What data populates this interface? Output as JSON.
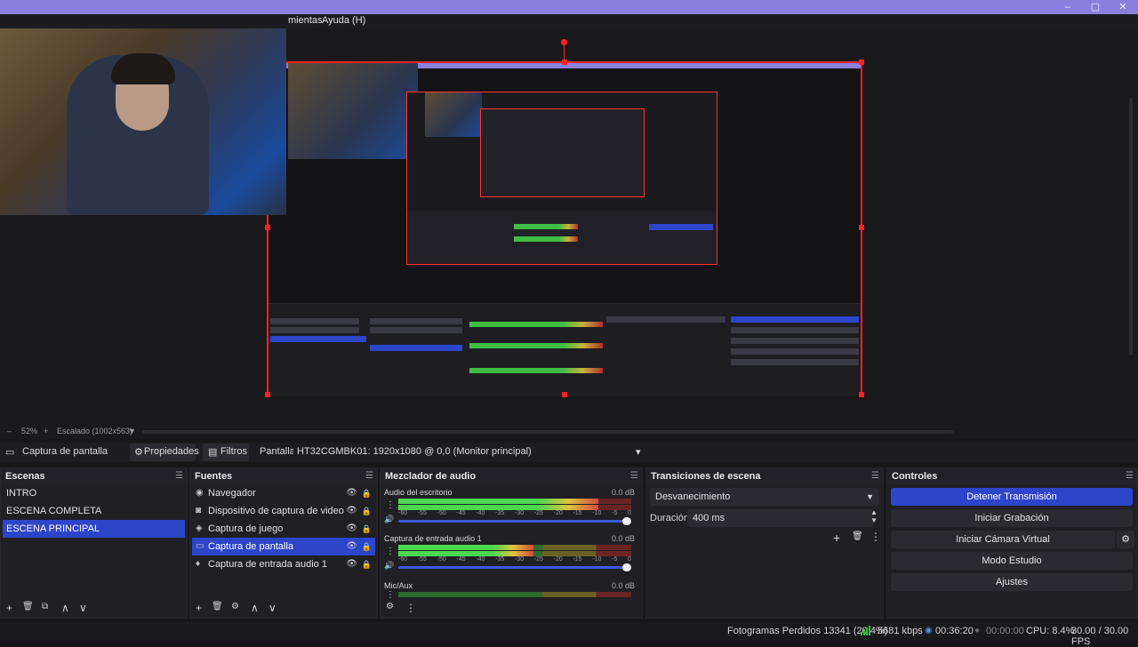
{
  "menubar": {
    "items": [
      "mientas",
      "Ayuda (H)"
    ]
  },
  "window_controls": {
    "min": "–",
    "max": "▢",
    "close": "✕"
  },
  "zoombar": {
    "zoom": "52%",
    "plus": "+",
    "scaled": "Escalado (1002x563)",
    "caret": "▼"
  },
  "context": {
    "source": "Captura de pantalla",
    "properties": "Propiedades",
    "filters": "Filtros",
    "display_label": "Pantalla",
    "display_value": "HT32CGMBK01: 1920x1080 @ 0,0 (Monitor principal)",
    "caret": "▾"
  },
  "scenes": {
    "title": "Escenas",
    "items": [
      {
        "label": "INTRO",
        "selected": false
      },
      {
        "label": "ESCENA COMPLETA",
        "selected": false
      },
      {
        "label": "ESCENA PRINCIPAL",
        "selected": true
      }
    ],
    "footer": [
      "+",
      "🗑",
      "⧉",
      "∧",
      "∨"
    ]
  },
  "sources": {
    "title": "Fuentes",
    "items": [
      {
        "icon": "◉",
        "label": "Navegador",
        "selected": false
      },
      {
        "icon": "◙",
        "label": "Dispositivo de captura de video",
        "selected": false
      },
      {
        "icon": "◈",
        "label": "Captura de juego",
        "selected": false
      },
      {
        "icon": "▭",
        "label": "Captura de pantalla",
        "selected": true
      },
      {
        "icon": "♦",
        "label": "Captura de entrada audio 1",
        "selected": false
      }
    ],
    "eye": "👁",
    "lock": "🔒",
    "footer": [
      "+",
      "🗑",
      "⚙",
      "∧",
      "∨"
    ]
  },
  "mixer": {
    "title": "Mezclador de audio",
    "scale": [
      "-60",
      "-55",
      "-50",
      "-45",
      "-40",
      "-35",
      "-30",
      "-25",
      "-20",
      "-15",
      "-10",
      "-5",
      "0"
    ],
    "channels": [
      {
        "name": "Audio del escritorio",
        "db": "0.0 dB",
        "level": 0.86
      },
      {
        "name": "Captura de entrada audio 1",
        "db": "0.0 dB",
        "level": 0.58
      },
      {
        "name": "Mic/Aux",
        "db": "0.0 dB",
        "level": 0.0
      }
    ],
    "speaker": "🔊",
    "footer": [
      "⚙",
      "⋮"
    ]
  },
  "transitions": {
    "title": "Transiciones de escena",
    "selected": "Desvanecimiento",
    "duration_label": "Duración",
    "duration_value": "400 ms",
    "add": "+",
    "remove": "🗑",
    "more": "⋮"
  },
  "controls": {
    "title": "Controles",
    "buttons": [
      {
        "label": "Detener Transmisión",
        "primary": true
      },
      {
        "label": "Iniciar Grabación",
        "primary": false
      },
      {
        "label": "Iniciar Cámara Virtual",
        "primary": false
      },
      {
        "label": "Modo Estudio",
        "primary": false
      },
      {
        "label": "Ajustes",
        "primary": false
      }
    ],
    "gear": "⚙"
  },
  "status": {
    "dropped": "Fotogramas Perdidos 13341 (20.4%)",
    "kbps": "5681 kbps",
    "stream_time": "00:36:20",
    "rec_time": "00:00:00",
    "cpu": "CPU: 8.4%",
    "fps": "30.00 / 30.00 FPS"
  },
  "colors": {
    "accent": "#2d45c8",
    "titlebar": "#8b7fdc",
    "selection_outline": "#ff2222"
  }
}
